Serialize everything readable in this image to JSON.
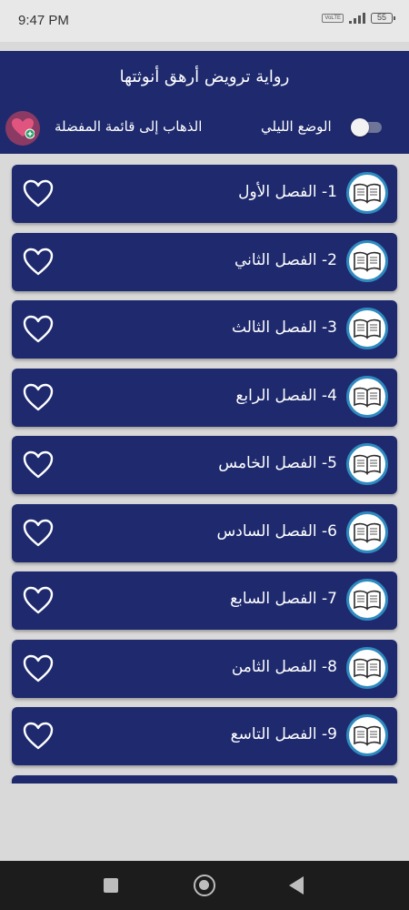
{
  "status_bar": {
    "time": "9:47 PM",
    "battery": "55",
    "network_badge": "VoLTE"
  },
  "header": {
    "title": "رواية ترويض أرهق أنوثتها",
    "night_mode_label": "الوضع الليلي",
    "night_mode_on": false,
    "favorites_link": "الذهاب إلى قائمة المفضلة"
  },
  "chapters": [
    {
      "label": "1- الفصل الأول"
    },
    {
      "label": "2- الفصل الثاني"
    },
    {
      "label": "3- الفصل الثالث"
    },
    {
      "label": "4- الفصل الرابع"
    },
    {
      "label": "5- الفصل الخامس"
    },
    {
      "label": "6- الفصل السادس"
    },
    {
      "label": "7- الفصل السابع"
    },
    {
      "label": "8- الفصل الثامن"
    },
    {
      "label": "9- الفصل التاسع"
    }
  ],
  "colors": {
    "primary": "#1f2a6e",
    "background": "#d9d9d9",
    "badge_border": "#2e8bc0",
    "favorite_accent": "#e0557f"
  },
  "icons": [
    "book-icon",
    "heart-outline-icon",
    "heart-add-icon",
    "toggle-switch"
  ]
}
